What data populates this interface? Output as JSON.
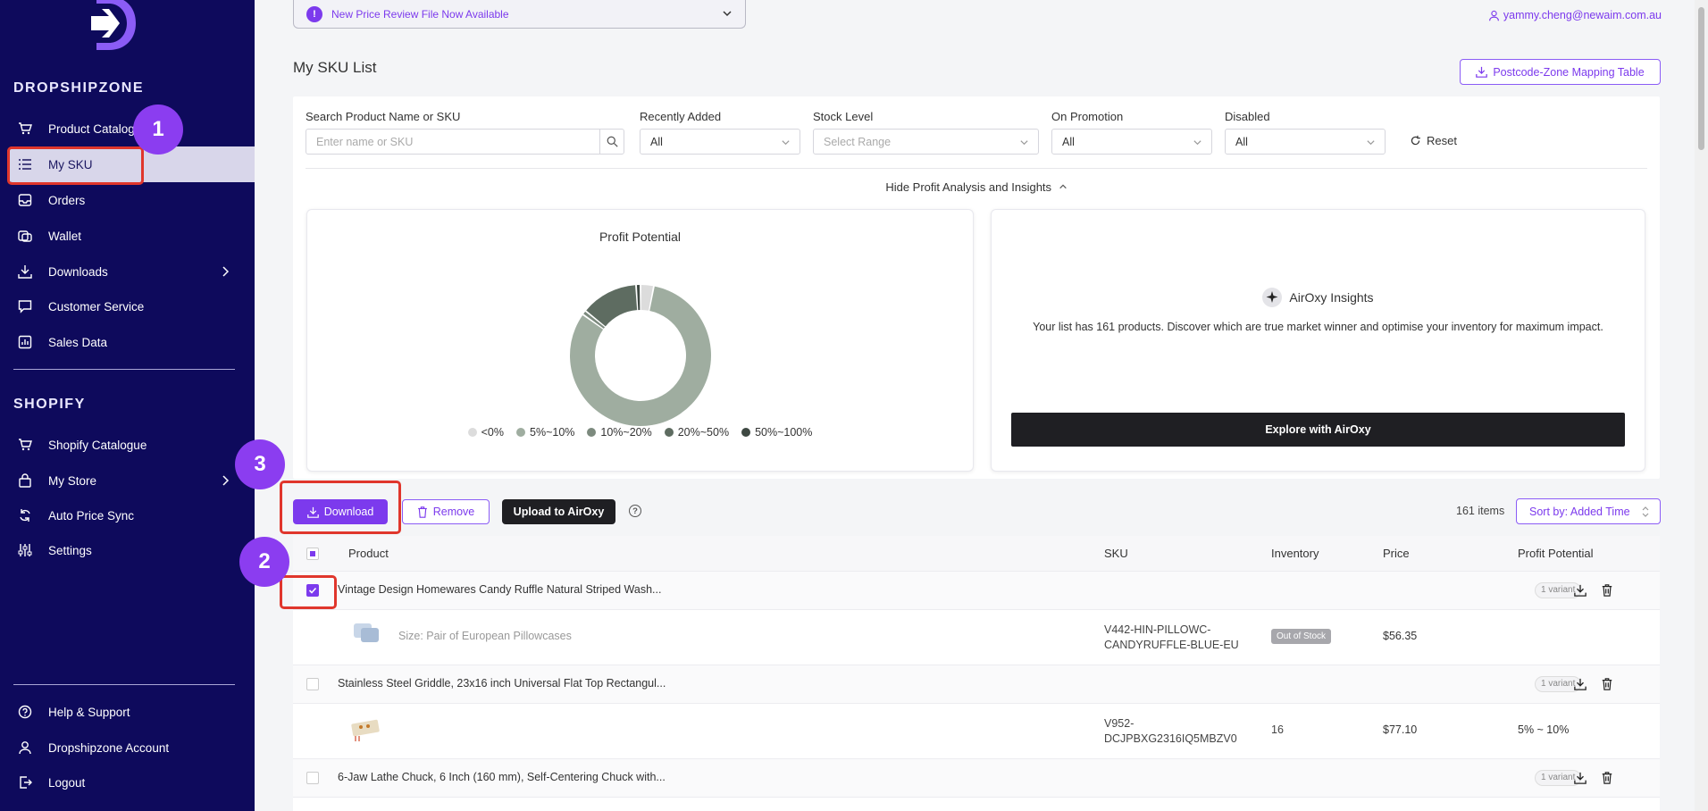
{
  "sidebar": {
    "brand_section": "DROPSHIPZONE",
    "shopify_section": "SHOPIFY",
    "dsz_items": [
      {
        "label": "Product Catalogue",
        "icon": "cart-icon"
      },
      {
        "label": "My SKU",
        "icon": "list-icon"
      },
      {
        "label": "Orders",
        "icon": "inbox-icon"
      },
      {
        "label": "Wallet",
        "icon": "wallet-icon"
      },
      {
        "label": "Downloads",
        "icon": "download-icon"
      },
      {
        "label": "Customer Service",
        "icon": "chat-icon"
      },
      {
        "label": "Sales Data",
        "icon": "chart-icon"
      }
    ],
    "shopify_items": [
      {
        "label": "Shopify Catalogue",
        "icon": "cart-icon"
      },
      {
        "label": "My Store",
        "icon": "bag-icon"
      },
      {
        "label": "Auto Price Sync",
        "icon": "sync-icon"
      },
      {
        "label": "Settings",
        "icon": "sliders-icon"
      }
    ],
    "bottom_items": [
      {
        "label": "Help & Support",
        "icon": "help-icon"
      },
      {
        "label": "Dropshipzone Account",
        "icon": "user-icon"
      },
      {
        "label": "Logout",
        "icon": "logout-icon"
      }
    ]
  },
  "header": {
    "banner_text": "New Price Review File Now Available",
    "user_email": "yammy.cheng@newaim.com.au"
  },
  "page": {
    "title": "My SKU List",
    "mapping_button": "Postcode-Zone Mapping Table"
  },
  "filters": {
    "search_label": "Search Product Name or SKU",
    "search_placeholder": "Enter name or SKU",
    "recent_label": "Recently Added",
    "recent_value": "All",
    "stock_label": "Stock Level",
    "stock_placeholder": "Select Range",
    "promo_label": "On Promotion",
    "promo_value": "All",
    "disabled_label": "Disabled",
    "disabled_value": "All",
    "reset": "Reset"
  },
  "insights": {
    "toggle": "Hide Profit Analysis and Insights",
    "profit_title": "Profit Potential",
    "legend": [
      {
        "label": "<0%",
        "color": "#dcdcdc"
      },
      {
        "label": "5%~10%",
        "color": "#9fada0"
      },
      {
        "label": "10%~20%",
        "color": "#7c8a7e"
      },
      {
        "label": "20%~50%",
        "color": "#5e6c61"
      },
      {
        "label": "50%~100%",
        "color": "#3e4842"
      }
    ],
    "airoxy_title": "AirOxy Insights",
    "airoxy_desc": "Your list has 161 products. Discover which are true market winner and optimise your inventory for maximum impact.",
    "explore_button": "Explore with AirOxy"
  },
  "chart_data": {
    "type": "pie",
    "title": "Profit Potential",
    "categories": [
      "<0%",
      "5%~10%",
      "10%~20%",
      "20%~50%",
      "50%~100%"
    ],
    "values": [
      3,
      81,
      1,
      13,
      1
    ],
    "colors": [
      "#dcdcdc",
      "#9fada0",
      "#7c8a7e",
      "#5e6c61",
      "#3e4842"
    ]
  },
  "actions": {
    "download": "Download",
    "remove": "Remove",
    "upload": "Upload to AirOxy",
    "help": "?",
    "items_count": "161 items",
    "sort": "Sort by: Added Time"
  },
  "table": {
    "headers": {
      "product": "Product",
      "sku": "SKU",
      "inventory": "Inventory",
      "price": "Price",
      "profit": "Profit Potential"
    },
    "rows": [
      {
        "title": "Vintage Design Homewares Candy Ruffle Natural Striped Wash...",
        "variants": "1 variant",
        "variant_name": "Size: Pair of European Pillowcases",
        "sku_line1": "V442-HIN-PILLOWC-",
        "sku_line2": "CANDYRUFFLE-BLUE-EU",
        "inventory": "Out of Stock",
        "price": "$56.35",
        "profit": ""
      },
      {
        "title": "Stainless Steel Griddle, 23x16 inch Universal Flat Top Rectangul...",
        "variants": "1 variant",
        "variant_name": "",
        "sku_line1": "V952-",
        "sku_line2": "DCJPBXG2316IQ5MBZV0",
        "inventory": "16",
        "price": "$77.10",
        "profit": "5% ~ 10%"
      },
      {
        "title": "6-Jaw Lathe Chuck, 6 Inch (160 mm), Self-Centering Chuck with...",
        "variants": "1 variant"
      }
    ]
  },
  "annotations": [
    "1",
    "2",
    "3"
  ],
  "colors": {
    "sidebar": "#0e0a5c",
    "accent": "#7c3aed",
    "annotation": "#8b3df0",
    "highlight_box": "#e0362c"
  }
}
